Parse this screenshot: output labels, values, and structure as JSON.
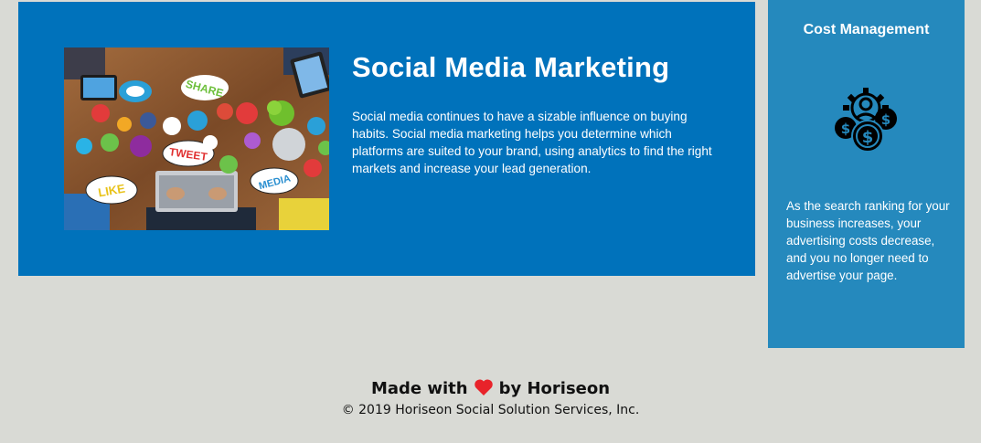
{
  "article": {
    "title": "Social Media Marketing",
    "body": "Social media continues to have a sizable influence on buying habits. Social media marketing helps you determine which platforms are suited to your brand, using analytics to find the right markets and increase your lead generation.",
    "image_labels": [
      "SHARE",
      "TWEET",
      "LIKE",
      "MEDIA"
    ]
  },
  "benefit": {
    "title": "Cost Management",
    "icon": "cost-management-icon",
    "body": "As the search ranking for your business increases, your advertising costs decrease, and you no longer need to advertise your page."
  },
  "footer": {
    "made_with": "Made with",
    "by": "by Horiseon",
    "copyright": "© 2019 Horiseon Social Solution Services, Inc."
  },
  "colors": {
    "article_bg": "#0072bb",
    "benefit_bg": "#2589bd",
    "page_bg": "#d9dad5",
    "heart": "#e8232a"
  }
}
